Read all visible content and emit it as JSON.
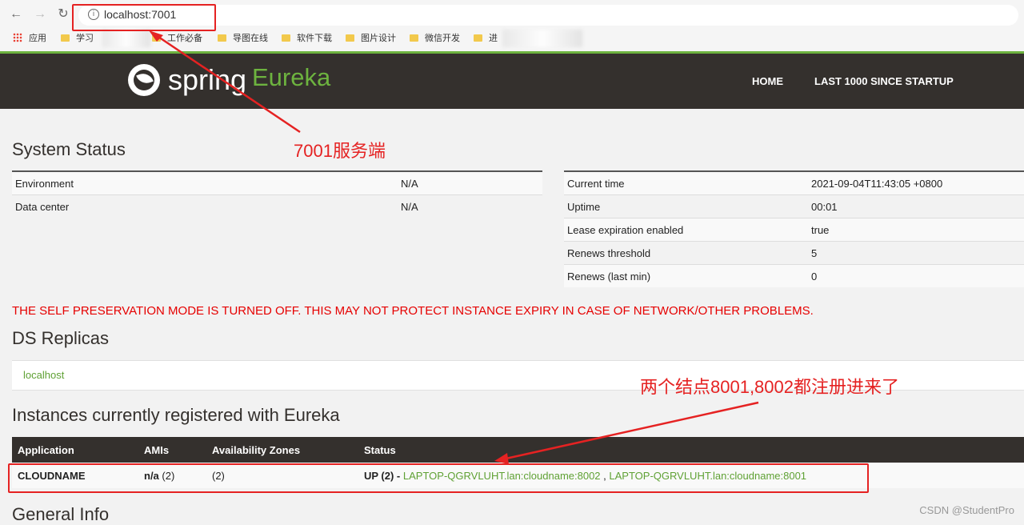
{
  "browser": {
    "url": "localhost:7001",
    "bookmarks": [
      "应用",
      "学习",
      "工作必备",
      "导图在线",
      "软件下载",
      "图片设计",
      "微信开发",
      "进"
    ]
  },
  "eureka_nav": {
    "brand_spring": "spring",
    "brand_eureka": "Eureka",
    "home": "HOME",
    "last1000": "LAST 1000 SINCE STARTUP"
  },
  "system_status": {
    "title": "System Status",
    "left": [
      {
        "label": "Environment",
        "value": "N/A"
      },
      {
        "label": "Data center",
        "value": "N/A"
      }
    ],
    "right": [
      {
        "label": "Current time",
        "value": "2021-09-04T11:43:05 +0800"
      },
      {
        "label": "Uptime",
        "value": "00:01"
      },
      {
        "label": "Lease expiration enabled",
        "value": "true"
      },
      {
        "label": "Renews threshold",
        "value": "5"
      },
      {
        "label": "Renews (last min)",
        "value": "0"
      }
    ]
  },
  "warning": "THE SELF PRESERVATION MODE IS TURNED OFF. THIS MAY NOT PROTECT INSTANCE EXPIRY IN CASE OF NETWORK/OTHER PROBLEMS.",
  "ds_replicas": {
    "title": "DS Replicas",
    "items": [
      "localhost"
    ]
  },
  "instances": {
    "title": "Instances currently registered with Eureka",
    "headers": [
      "Application",
      "AMIs",
      "Availability Zones",
      "Status"
    ],
    "rows": [
      {
        "application": "CLOUDNAME",
        "amis_prefix": "n/a",
        "amis_count": "(2)",
        "zones": "(2)",
        "status_prefix": "UP (2) - ",
        "links": [
          "LAPTOP-QGRVLUHT.lan:cloudname:8002",
          "LAPTOP-QGRVLUHT.lan:cloudname:8001"
        ],
        "link_sep": " , "
      }
    ]
  },
  "general_info_title": "General Info",
  "annotations": {
    "server_note": "7001服务端",
    "nodes_note": "两个结点8001,8002都注册进来了"
  },
  "watermark": "CSDN @StudentPro",
  "colors": {
    "spring_green": "#6db33f",
    "navbar_bg": "#34302d",
    "warning_red": "#e60000",
    "annotation_red": "#e52222"
  }
}
